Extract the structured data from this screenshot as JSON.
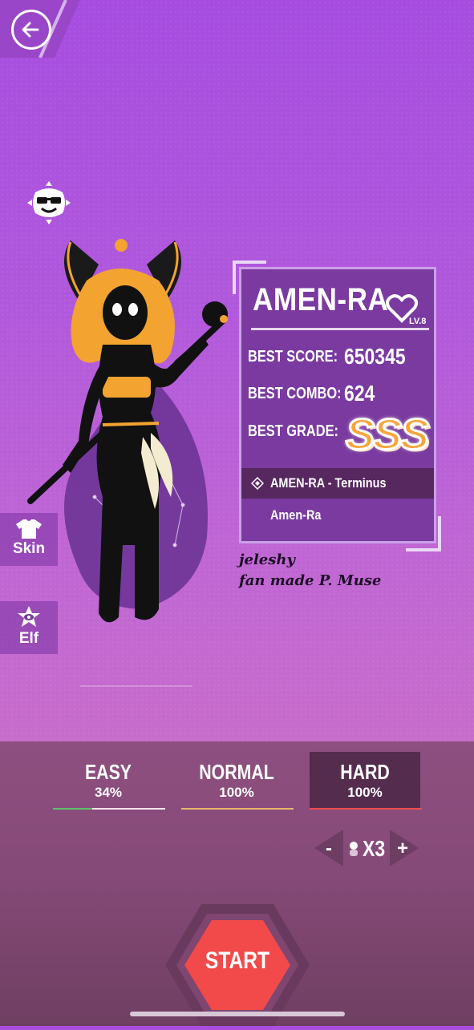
{
  "song": {
    "title": "AMEN-RA",
    "level": "LV.8"
  },
  "stats": {
    "best_score_label": "BEST SCORE:",
    "best_score": "650345",
    "best_combo_label": "BEST COMBO:",
    "best_combo": "624",
    "best_grade_label": "BEST GRADE:",
    "best_grade": "SSS"
  },
  "chart_list": {
    "selected": "AMEN-RA - Terminus",
    "other": "Amen-Ra"
  },
  "credits": {
    "line1": "jeleshy",
    "line2": "fan made P. Muse"
  },
  "side_buttons": {
    "skin": "Skin",
    "elf": "Elf"
  },
  "difficulties": [
    {
      "name": "EASY",
      "percent": "34%"
    },
    {
      "name": "NORMAL",
      "percent": "100%"
    },
    {
      "name": "HARD",
      "percent": "100%"
    }
  ],
  "selected_difficulty": "HARD",
  "multiplier": {
    "minus": "-",
    "value": "X3",
    "plus": "+"
  },
  "start_label": "START",
  "colors": {
    "accent_start": "#f24a4a",
    "grade": "#f7a43a",
    "card": "#7a3aa0",
    "easy_bar": "#5fbf6b",
    "normal_bar": "#e8b66a",
    "hard_bar": "#e94d4d"
  }
}
